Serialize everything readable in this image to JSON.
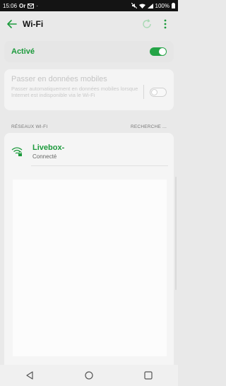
{
  "status_bar": {
    "time": "15:06",
    "operator": "Or",
    "battery": "100%"
  },
  "header": {
    "title": "Wi-Fi"
  },
  "wifi_toggle": {
    "label": "Activé",
    "state": "on"
  },
  "mobile_data": {
    "title": "Passer en données mobiles",
    "description": "Passer automatiquement en données mobiles lorsque Internet est indisponible via le Wi-Fi",
    "state": "off"
  },
  "networks": {
    "header": "RÉSEAUX WI-FI",
    "search_label": "RECHERCHE ...",
    "connected": {
      "name": "Livebox-",
      "status": "Connecté"
    }
  },
  "colors": {
    "accent": "#1c9a3c",
    "toggle_on": "#24a446"
  }
}
